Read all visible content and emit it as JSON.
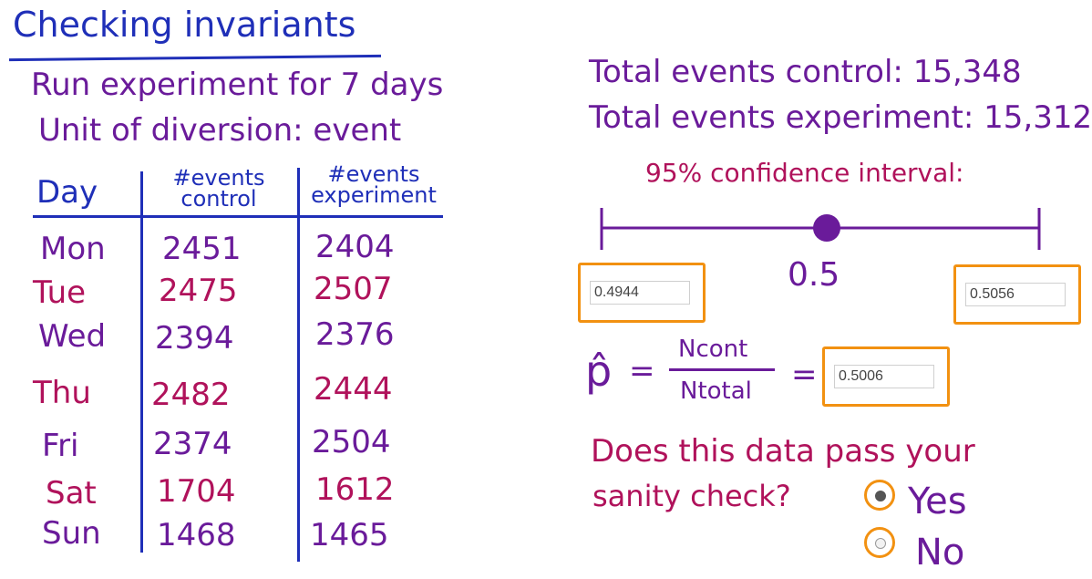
{
  "title": "Checking invariants",
  "subtitle_1": "Run experiment for 7 days",
  "subtitle_2": "Unit of diversion: event",
  "table": {
    "headers": [
      "Day",
      "#events control",
      "#events experiment"
    ],
    "rows": [
      {
        "day": "Mon",
        "control": "2451",
        "experiment": "2404"
      },
      {
        "day": "Tue",
        "control": "2475",
        "experiment": "2507"
      },
      {
        "day": "Wed",
        "control": "2394",
        "experiment": "2376"
      },
      {
        "day": "Thu",
        "control": "2482",
        "experiment": "2444"
      },
      {
        "day": "Fri",
        "control": "2374",
        "experiment": "2504"
      },
      {
        "day": "Sat",
        "control": "1704",
        "experiment": "1612"
      },
      {
        "day": "Sun",
        "control": "1468",
        "experiment": "1465"
      }
    ]
  },
  "totals": {
    "control": "Total events control: 15,348",
    "experiment": "Total events experiment: 15,312"
  },
  "interval": {
    "label": "95% confidence interval:",
    "center": "0.5",
    "lower_input": "0.4944",
    "upper_input": "0.5056"
  },
  "formula": {
    "lhs": "p̂",
    "equals": "=",
    "numerator": "Ncont",
    "denominator": "Ntotal",
    "result_input": "0.5006"
  },
  "question": {
    "line1": "Does this data pass your",
    "line2": "sanity check?",
    "options": [
      {
        "label": "Yes",
        "selected": true
      },
      {
        "label": "No",
        "selected": false
      }
    ]
  },
  "colors": {
    "blue": "#1f2fb8",
    "purple": "#6a1b9a",
    "magenta": "#b0125b",
    "box_orange": "#f29111"
  }
}
